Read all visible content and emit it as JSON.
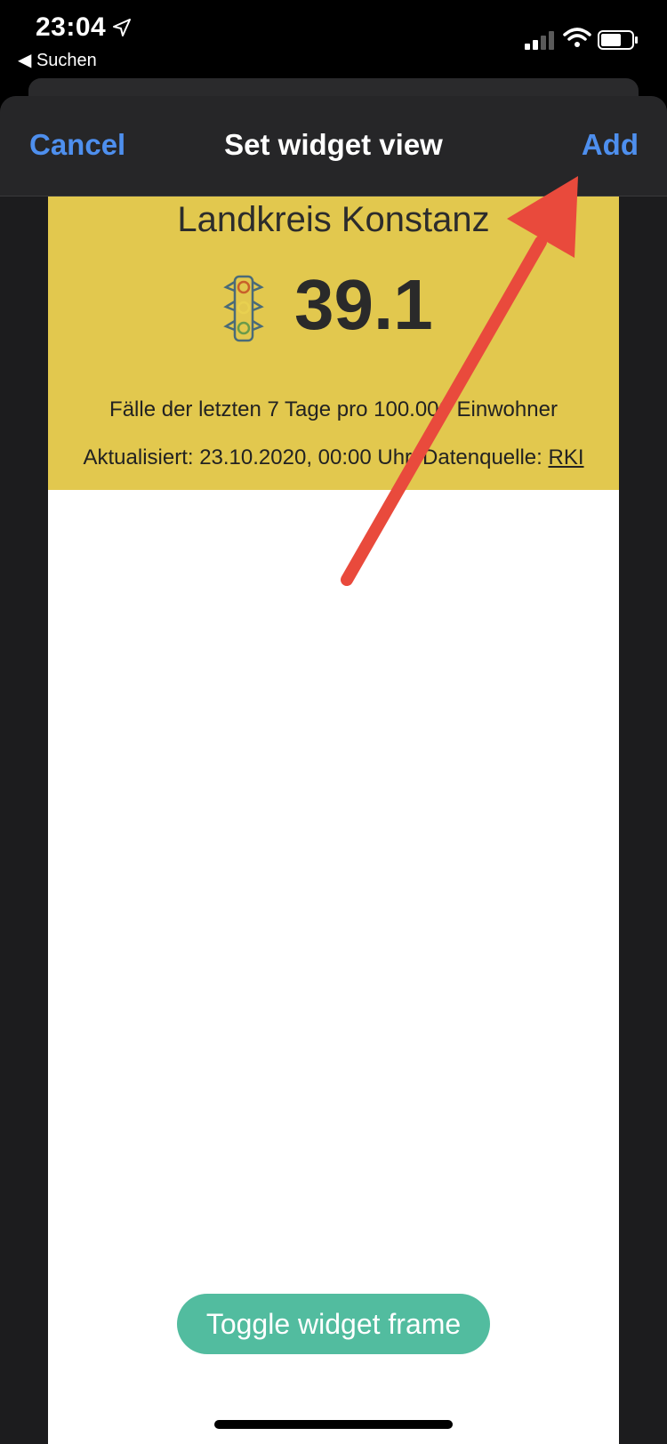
{
  "status_bar": {
    "time": "23:04",
    "back_label": "◀ Suchen",
    "icons": [
      "location-arrow-icon",
      "cellular-signal-icon",
      "wifi-icon",
      "battery-icon"
    ]
  },
  "nav": {
    "cancel_label": "Cancel",
    "title": "Set widget view",
    "add_label": "Add"
  },
  "widget": {
    "region": "Landkreis Konstanz",
    "icon": "traffic-light-icon",
    "value": "39.1",
    "description": "Fälle der letzten 7 Tage pro 100.000 Einwohner",
    "updated_prefix": "Aktualisiert: 23.10.2020, 00:00 Uhr, Datenquelle: ",
    "source_link": "RKI",
    "background": "#e2c84e"
  },
  "toggle_button": {
    "label": "Toggle widget frame",
    "color": "#52bc9f"
  },
  "colors": {
    "accent": "#4e8fee",
    "annotation_arrow": "#e94a3c"
  }
}
